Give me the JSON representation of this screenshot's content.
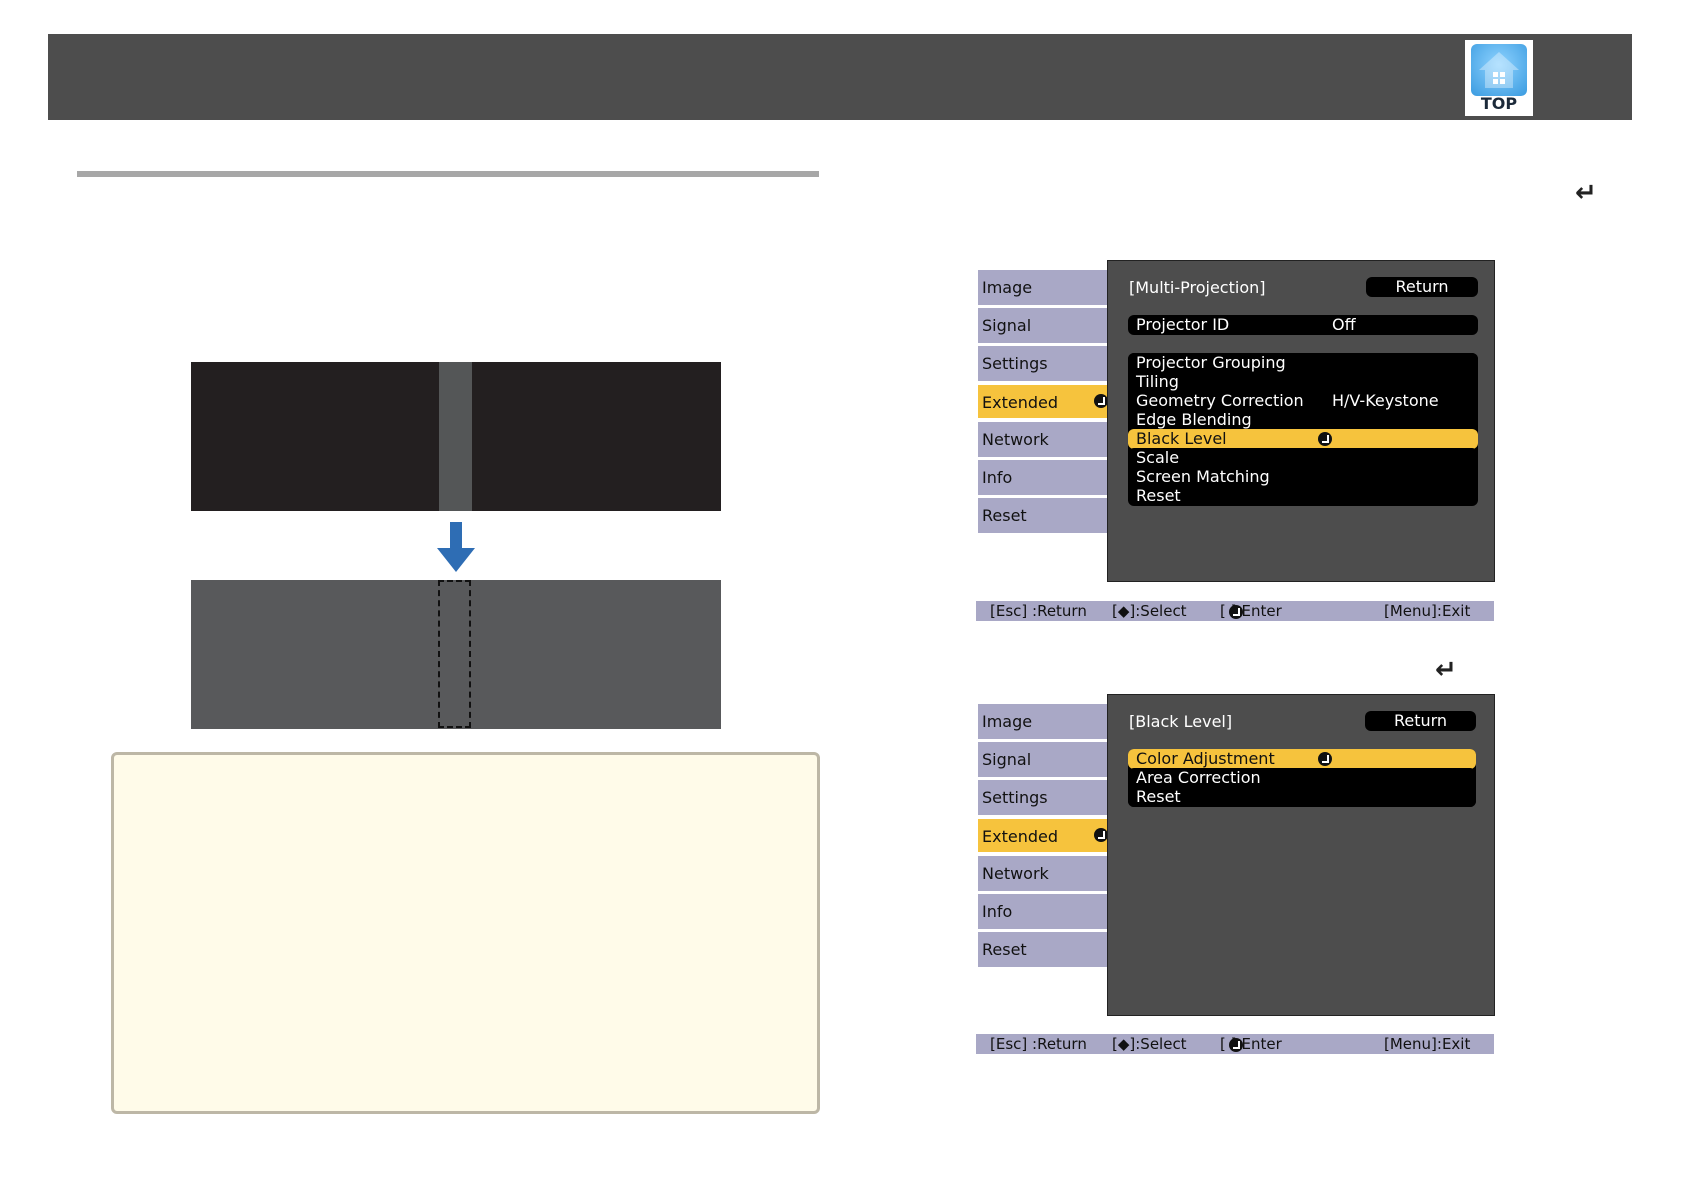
{
  "header": {
    "top_badge_label": "TOP",
    "logo_icon": "home-icon"
  },
  "enter_mark": "↵",
  "menu_tabs": [
    "Image",
    "Signal",
    "Settings",
    "Extended",
    "Network",
    "Info",
    "Reset"
  ],
  "active_tab": "Extended",
  "colors": {
    "highlight": "#f6c33d",
    "tab": "#a9a8c6",
    "panel": "#4d4d4d",
    "header": "#4d4d4d",
    "note_bg": "#fffbe9"
  },
  "menu1": {
    "title": "[Multi-Projection]",
    "return_label": "Return",
    "projector_id": {
      "label": "Projector ID",
      "value": "Off"
    },
    "items": [
      {
        "label": "Projector Grouping"
      },
      {
        "label": "Tiling"
      },
      {
        "label": "Geometry Correction",
        "value": "H/V-Keystone"
      },
      {
        "label": "Edge Blending"
      },
      {
        "label": "Black Level",
        "selected": true
      },
      {
        "label": "Scale"
      },
      {
        "label": "Screen Matching"
      },
      {
        "label": "Reset"
      }
    ]
  },
  "menu2": {
    "title": "[Black Level]",
    "return_label": "Return",
    "items": [
      {
        "label": "Color Adjustment",
        "selected": true
      },
      {
        "label": "Area Correction"
      },
      {
        "label": "Reset"
      }
    ]
  },
  "footer": {
    "esc": "[Esc] :Return",
    "select": "[◆]:Select",
    "enter": "[ ]:Enter",
    "exit": "[Menu]:Exit"
  }
}
